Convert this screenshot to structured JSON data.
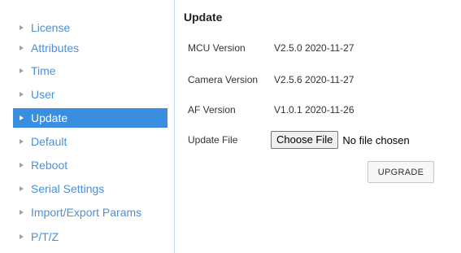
{
  "sidebar": {
    "items": [
      {
        "label": "License",
        "active": false
      },
      {
        "label": "Attributes",
        "active": false
      },
      {
        "label": "Time",
        "active": false
      },
      {
        "label": "User",
        "active": false
      },
      {
        "label": "Update",
        "active": true
      },
      {
        "label": "Default",
        "active": false
      },
      {
        "label": "Reboot",
        "active": false
      },
      {
        "label": "Serial Settings",
        "active": false
      },
      {
        "label": "Import/Export Params",
        "active": false
      },
      {
        "label": "P/T/Z",
        "active": false
      }
    ],
    "arrow_icon": "triangle-right-icon",
    "link_color": "#4a90d9",
    "active_color": "#3a8ee0"
  },
  "main": {
    "title": "Update",
    "mcu_version": {
      "label": "MCU Version",
      "value": "V2.5.0 2020-11-27"
    },
    "camera_version": {
      "label": "Camera Version",
      "value": "V2.5.6 2020-11-27"
    },
    "af_version": {
      "label": "AF Version",
      "value": "V1.0.1 2020-11-26"
    },
    "update_file": {
      "label": "Update File",
      "button_label": "Choose File",
      "status": "No file chosen"
    },
    "upgrade_button_label": "UPGRADE"
  }
}
